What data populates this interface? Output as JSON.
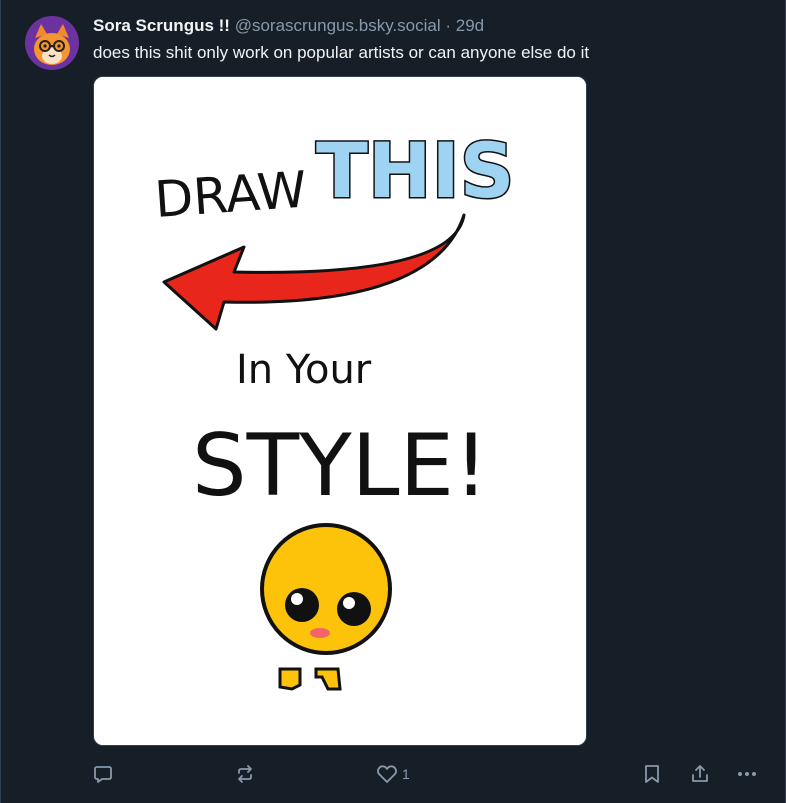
{
  "post": {
    "author": {
      "display_name": "Sora Scrungus !!",
      "handle": "@sorascrungus.bsky.social",
      "separator": "·",
      "time": "29d"
    },
    "text": "does this shit only work on popular artists or can anyone else do it",
    "image": {
      "title_left": "DRAW",
      "title_right": "THIS",
      "middle": "In Your",
      "bottom": "STYLE!"
    },
    "actions": {
      "reply_icon": "speech-bubble-icon",
      "repost_icon": "repost-arrows-icon",
      "like_icon": "heart-icon",
      "like_count": "1",
      "bookmark_icon": "bookmark-icon",
      "share_icon": "share-icon",
      "more_icon": "ellipsis-icon"
    }
  },
  "colors": {
    "background": "#161e27",
    "text_secondary": "#8799ab",
    "arrow_red": "#e8261b",
    "this_blue": "#9ed3f2",
    "emoji_yellow": "#fdc20a"
  }
}
